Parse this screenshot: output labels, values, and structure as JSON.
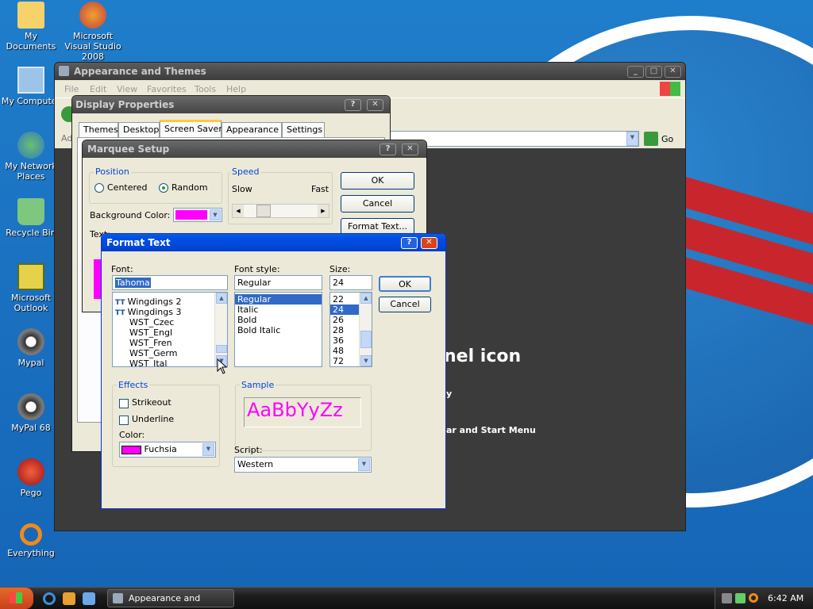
{
  "desktop": {
    "icons": [
      {
        "label": "My Documents",
        "icon": "documents-folder-icon"
      },
      {
        "label": "Microsoft Visual Studio 2008",
        "icon": "visual-studio-icon"
      },
      {
        "label": "My Computer",
        "icon": "computer-icon"
      },
      {
        "label": "My Network Places",
        "icon": "network-icon"
      },
      {
        "label": "Recycle Bin",
        "icon": "recycle-bin-icon"
      },
      {
        "label": "Microsoft Outlook",
        "icon": "outlook-icon"
      },
      {
        "label": "Mypal",
        "icon": "mypal-icon"
      },
      {
        "label": "MyPal 68",
        "icon": "mypal-icon"
      },
      {
        "label": "Pego",
        "icon": "pego-icon"
      },
      {
        "label": "Everything",
        "icon": "search-ring-icon"
      }
    ]
  },
  "explorer": {
    "title": "Appearance and Themes",
    "menu": [
      "File",
      "Edit",
      "View",
      "Favorites",
      "Tools",
      "Help"
    ],
    "go": "Go",
    "heading": "nel icon",
    "line1": "y",
    "line2": "ar and Start Menu"
  },
  "display": {
    "title": "Display Properties",
    "tabs": [
      "Themes",
      "Desktop",
      "Screen Saver",
      "Appearance",
      "Settings"
    ]
  },
  "marquee": {
    "title": "Marquee Setup",
    "position_label": "Position",
    "centered": "Centered",
    "random": "Random",
    "speed_label": "Speed",
    "slow": "Slow",
    "fast": "Fast",
    "bg_label": "Background Color:",
    "text_label": "Text:",
    "ok": "OK",
    "cancel": "Cancel",
    "format_text": "Format Text..."
  },
  "format": {
    "title": "Format Text",
    "font_label": "Font:",
    "font_value": "Tahoma",
    "fonts": [
      "Wingdings 2",
      "Wingdings 3",
      "WST_Czec",
      "WST_Engl",
      "WST_Fren",
      "WST_Germ",
      "WST_Ital"
    ],
    "style_label": "Font style:",
    "style_value": "Regular",
    "styles": [
      "Regular",
      "Italic",
      "Bold",
      "Bold Italic"
    ],
    "size_label": "Size:",
    "size_value": "24",
    "sizes": [
      "22",
      "24",
      "26",
      "28",
      "36",
      "48",
      "72"
    ],
    "ok": "OK",
    "cancel": "Cancel",
    "effects_label": "Effects",
    "strikeout": "Strikeout",
    "underline": "Underline",
    "color_label": "Color:",
    "color_value": "Fuchsia",
    "sample_label": "Sample",
    "sample_text": "AaBbYyZz",
    "script_label": "Script:",
    "script_value": "Western"
  },
  "taskbar": {
    "task": "Appearance and Themes",
    "clock": "6:42 AM"
  },
  "colors": {
    "fuchsia": "#ff00ff",
    "select": "#316ac5",
    "xp_blue": "#0a246a",
    "title_gray": "#4a4a4a"
  }
}
